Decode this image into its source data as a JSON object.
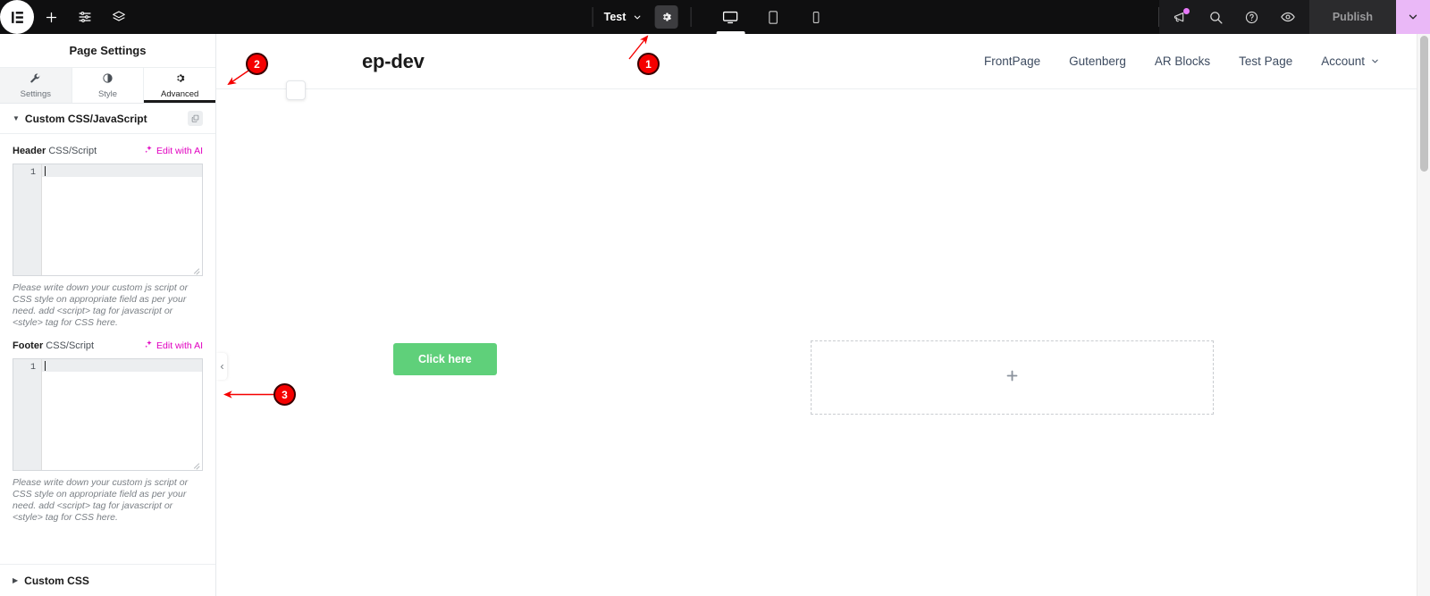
{
  "topbar": {
    "logo_icon": "elementor-logo-icon",
    "add_icon": "plus-icon",
    "settings_sliders_icon": "sliders-icon",
    "layers_icon": "layers-icon",
    "document_name": "Test",
    "document_caret_icon": "chevron-down-icon",
    "page_settings_icon": "gear-icon",
    "devices": [
      {
        "name": "desktop-view",
        "icon": "desktop-icon",
        "active": true
      },
      {
        "name": "tablet-view",
        "icon": "tablet-icon",
        "active": false
      },
      {
        "name": "mobile-view",
        "icon": "mobile-icon",
        "active": false
      }
    ],
    "whats_new_icon": "megaphone-icon",
    "finder_icon": "search-icon",
    "help_icon": "question-circle-icon",
    "preview_icon": "eye-icon",
    "publish_label": "Publish",
    "publish_caret_icon": "chevron-down-icon",
    "accent_pink": "#eab8f7",
    "notification_dot_color": "#e879f9"
  },
  "sidebar": {
    "panel_title": "Page Settings",
    "tabs": [
      {
        "label": "Settings",
        "icon": "wrench-icon",
        "active": false
      },
      {
        "label": "Style",
        "icon": "contrast-icon",
        "active": false
      },
      {
        "label": "Advanced",
        "icon": "gear-icon",
        "active": true
      }
    ],
    "section": {
      "title": "Custom CSS/JavaScript",
      "collapse_caret": "caret-down-icon",
      "copy_badge_icon": "copy-icon"
    },
    "header_field": {
      "label_strong": "Header",
      "label_rest": " CSS/Script",
      "ai_link": "Edit with AI",
      "ai_icon": "sparkle-icon",
      "line_number": "1",
      "value": "",
      "help": "Please write down your custom js script or CSS style on appropriate field as per your need. add <script> tag for javascript or <style> tag for CSS here."
    },
    "footer_field": {
      "label_strong": "Footer",
      "label_rest": " CSS/Script",
      "ai_link": "Edit with AI",
      "ai_icon": "sparkle-icon",
      "line_number": "1",
      "value": "",
      "help": "Please write down your custom js script or CSS style on appropriate field as per your need. add <script> tag for javascript or <style> tag for CSS here."
    },
    "custom_css_section": {
      "title": "Custom CSS",
      "caret": "caret-right-icon"
    },
    "ai_link_color": "#e100c0"
  },
  "canvas": {
    "site_logo": "ep-dev",
    "nav": [
      {
        "label": "FrontPage",
        "caret": false
      },
      {
        "label": "Gutenberg",
        "caret": false
      },
      {
        "label": "AR Blocks",
        "caret": false
      },
      {
        "label": "Test Page",
        "caret": false
      },
      {
        "label": "Account",
        "caret": true
      }
    ],
    "add_section_button_icon": "add-section-icon",
    "collapse_handle_icon": "chevron-left-icon",
    "cta_button": "Click here",
    "cta_color": "#5fd07a",
    "dropzone_icon": "plus-icon"
  },
  "annotations": [
    {
      "label": "1",
      "target": "page-settings-gear"
    },
    {
      "label": "2",
      "target": "advanced-tab"
    },
    {
      "label": "3",
      "target": "footer-css-field"
    }
  ]
}
